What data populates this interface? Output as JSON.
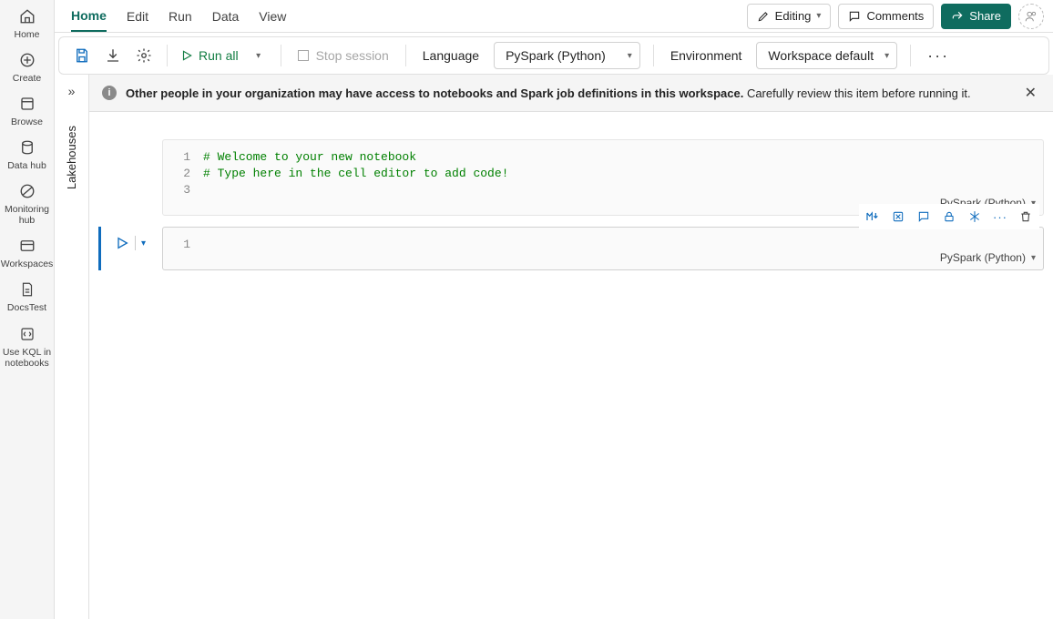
{
  "leftnav": {
    "items": [
      {
        "label": "Home"
      },
      {
        "label": "Create"
      },
      {
        "label": "Browse"
      },
      {
        "label": "Data hub"
      },
      {
        "label": "Monitoring hub"
      },
      {
        "label": "Workspaces"
      },
      {
        "label": "DocsTest"
      },
      {
        "label": "Use KQL in notebooks"
      }
    ]
  },
  "menubar": {
    "tabs": [
      "Home",
      "Edit",
      "Run",
      "Data",
      "View"
    ],
    "editing_label": "Editing",
    "comments_label": "Comments",
    "share_label": "Share"
  },
  "toolbar": {
    "run_all_label": "Run all",
    "stop_session_label": "Stop session",
    "language_label": "Language",
    "language_value": "PySpark (Python)",
    "environment_label": "Environment",
    "environment_value": "Workspace default"
  },
  "sidestrip": {
    "label": "Lakehouses"
  },
  "banner": {
    "bold": "Other people in your organization may have access to notebooks and Spark job definitions in this workspace.",
    "rest": "Carefully review this item before running it."
  },
  "cells": [
    {
      "active": false,
      "language": "PySpark (Python)",
      "lines": [
        "# Welcome to your new notebook",
        "# Type here in the cell editor to add code!",
        ""
      ]
    },
    {
      "active": true,
      "language": "PySpark (Python)",
      "lines": [
        ""
      ]
    }
  ]
}
